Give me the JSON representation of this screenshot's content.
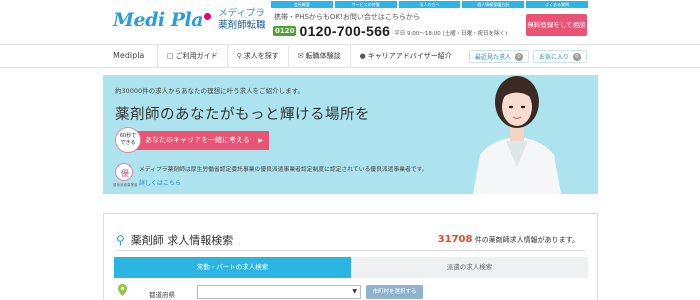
{
  "header": {
    "logo_text": "Medi Pla",
    "logo_sub1": "メディプラ",
    "logo_sub2": "薬剤師転職",
    "top_nav": [
      "会社概要",
      "サービスの特徴",
      "法人の方へ",
      "個人情報保護方針",
      "よくある質問"
    ],
    "phone_note": "携帯・PHSからもOK!お問い合せはこちらから",
    "freedial": "0120",
    "phone": "0120-700-566",
    "hours": "平日 9:00～18:00 (土曜・日曜・祝日を除く)",
    "cta": "無料登録をして相談する"
  },
  "subnav": {
    "brand": "Medipla",
    "items": [
      {
        "label": "ご利用ガイド",
        "icon": "book-icon"
      },
      {
        "label": "求人を探す",
        "icon": "search-icon"
      },
      {
        "label": "転職体験談",
        "icon": "chat-icon"
      },
      {
        "label": "キャリアアドバイザー紹介",
        "icon": "person-icon"
      }
    ],
    "recent": {
      "label": "最近見た求人",
      "count": "0"
    },
    "favorites": {
      "label": "お気に入り",
      "count": "0"
    }
  },
  "hero": {
    "note": "約30000件の求人からあなたの理想に叶う求人をご紹介します。",
    "headline": "薬剤師のあなたがもっと輝ける場所を",
    "badge_line1": "60秒で",
    "badge_line2": "できる",
    "button": "あなたのキャリアを一緒に考える",
    "cert_caption": "優良派遣事業者",
    "cert_text": "メディプラ薬剤師は厚生労働省認定委託事業の優良派遣事業者認定制度に認定されている優良派遣事業者です。",
    "cert_link": "詳しくはこちら"
  },
  "search": {
    "title": "薬剤師 求人情報検索",
    "count": "31708",
    "count_suffix": "件の薬剤師求人情報があります。",
    "tabs": [
      "常勤・パートの求人検索",
      "派遣の求人検索"
    ],
    "field_label": "都道府県",
    "select_value": "",
    "muni_button": "市町村を選択する"
  },
  "colors": {
    "accent": "#2cb5e3",
    "pink": "#ea5374",
    "hero_bg": "#ade3ee",
    "count_red": "#e8462b"
  }
}
